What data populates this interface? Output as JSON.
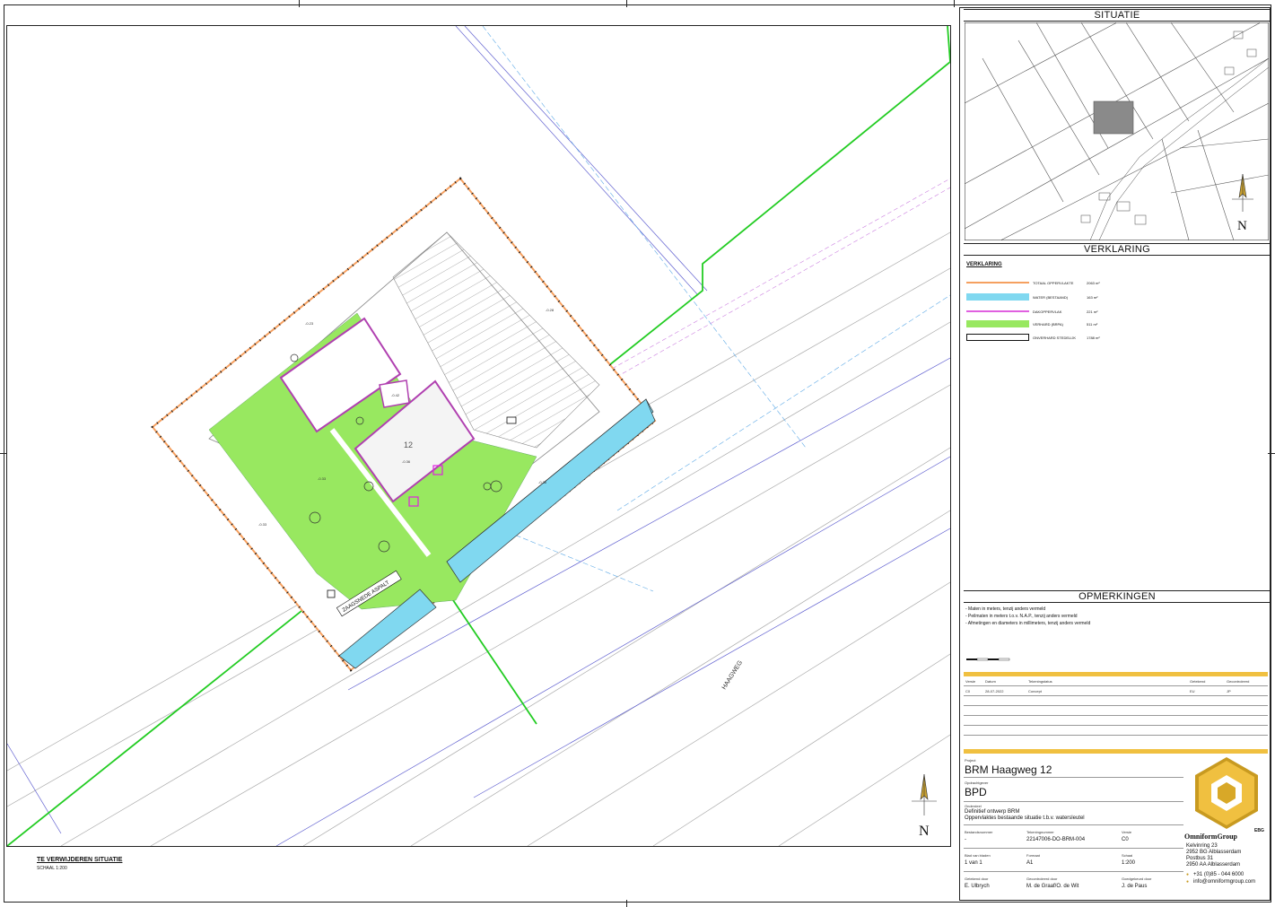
{
  "drawing": {
    "number_label": "12",
    "road_label": "HAAGWEG",
    "asphalt_label": "ZAAGSNEDE ASPALT",
    "level_labels": [
      "-0.23",
      "-0.33",
      "-0.42",
      "-0.36",
      "-0.33",
      "-0.28",
      "-0.36"
    ],
    "north": "N",
    "caption_title": "TE VERWIJDEREN SITUATIE",
    "caption_scale": "SCHAAL 1:200"
  },
  "panel": {
    "situatie_title": "SITUATIE",
    "verklaring_title": "VERKLARING",
    "opmerkingen_title": "OPMERKINGEN",
    "legend_heading": "VERKLARING",
    "legend": [
      {
        "label": "TOTAAL OPPERVLAKTE",
        "value": "2063 m²",
        "color": "#f5a060"
      },
      {
        "label": "WATER (BESTAAND)",
        "value": "163 m²",
        "color": "#80d8f0"
      },
      {
        "label": "DAKOPPERVLAK",
        "value": "221 m²",
        "color": "#e060e0"
      },
      {
        "label": "VERHARD (BRPA)",
        "value": "511 m²",
        "color": "#98e860"
      },
      {
        "label": "ONVERHARD STEDELIJK",
        "value": "1788 m²",
        "color": "#ffffff"
      }
    ],
    "remarks": [
      "- Maten in meters, tenzij anders vermeld",
      "- Peilmaten in meters t.o.v. N.A.P., tenzij anders vermeld",
      "- Afmetingen en diameters in millimeters, tenzij anders vermeld"
    ],
    "revision_headers": [
      "Versie",
      "Datum",
      "Tekeningstatus",
      "Getekend",
      "Gecontroleerd"
    ],
    "revision_row": [
      "C0",
      "28-07-2022",
      "Concept",
      "EU",
      "JP"
    ]
  },
  "titleblock": {
    "project_label": "Project",
    "project": "BRM Haagweg 12",
    "client_label": "Opdrachtgever",
    "client": "BPD",
    "subject_label": "Onderdeel",
    "subject_line1": "Definitief ontwerp BRM",
    "subject_line2": "Oppervlaktes bestaande situatie t.b.v. watersleutel",
    "opdracht_label": "Bestandsnummer",
    "opdracht_value": "-",
    "drawing_no_label": "Tekeningnummer",
    "drawing_no": "22147006-DO-BRM-004",
    "version_label": "Versie",
    "version": "C0",
    "sheet_label": "Blad van bladen",
    "sheet": "1   van   1",
    "format_label": "Formaat",
    "format": "A1",
    "scale_label": "Schaal",
    "scale": "1:200",
    "drawn_label": "Getekend door",
    "drawn_by": "E. Ulbrych",
    "checked_label": "Gecontroleerd door",
    "checked_by": "M. de Graaf/O. de Wit",
    "approved_label": "Goedgekeurd door",
    "approved_by": "J. de Paus",
    "company": "OmniformGroup",
    "company_suffix": "EBG",
    "address1": "Kelvinring 23",
    "address2": "2952 BG Alblasserdam",
    "address3": "Postbus 31",
    "address4": "2950 AA Alblasserdam",
    "phone": "+31 (0)85 - 044 6000",
    "email": "info@omniformgroup.com"
  }
}
